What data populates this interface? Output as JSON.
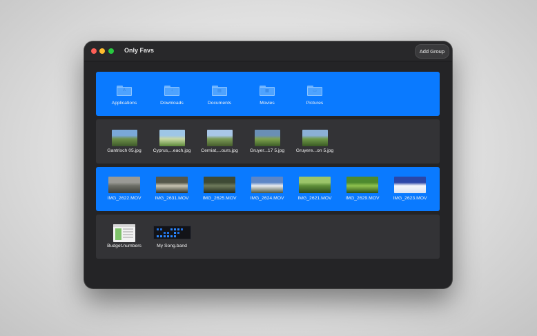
{
  "window": {
    "title": "Only Favs",
    "add_group_label": "Add Group"
  },
  "groups": [
    {
      "name": "folders",
      "selected": true,
      "items": [
        {
          "label": "Applications",
          "icon": "applications-folder-icon",
          "glyph": "A"
        },
        {
          "label": "Downloads",
          "icon": "downloads-folder-icon",
          "glyph": "↓"
        },
        {
          "label": "Documents",
          "icon": "documents-folder-icon",
          "glyph": "▤"
        },
        {
          "label": "Movies",
          "icon": "movies-folder-icon",
          "glyph": "▦"
        },
        {
          "label": "Pictures",
          "icon": "pictures-folder-icon",
          "glyph": "▭"
        }
      ]
    },
    {
      "name": "photos",
      "selected": false,
      "items": [
        {
          "label": "Gantrisch 05.jpg",
          "colors": [
            "#7aa8d8",
            "#6d8f4a",
            "#3e5a2a"
          ]
        },
        {
          "label": "Cyprus,...each.jpg",
          "colors": [
            "#9ec6e6",
            "#c9d9a3",
            "#5d8a3a"
          ]
        },
        {
          "label": "Cerniat,...ours.jpg",
          "colors": [
            "#a9c7e8",
            "#7c9b56",
            "#465d2c"
          ]
        },
        {
          "label": "Gruyer...17 5.jpg",
          "colors": [
            "#6a8fb5",
            "#7fa24e",
            "#3d5d27"
          ]
        },
        {
          "label": "Gruyere...on 5.jpg",
          "colors": [
            "#8bb0d6",
            "#6f9a49",
            "#3a5a23"
          ]
        }
      ]
    },
    {
      "name": "videos",
      "selected": true,
      "items": [
        {
          "label": "IMG_2622.MOV",
          "colors": [
            "#9a9a95",
            "#6b6e66",
            "#3f423c"
          ]
        },
        {
          "label": "IMG_2631.MOV",
          "colors": [
            "#55574a",
            "#c9c5b4",
            "#2f3328"
          ]
        },
        {
          "label": "IMG_2625.MOV",
          "colors": [
            "#3e4a35",
            "#6f7b5d",
            "#222a1c"
          ]
        },
        {
          "label": "IMG_2624.MOV",
          "colors": [
            "#5d86c6",
            "#e9ecf0",
            "#4a5640"
          ]
        },
        {
          "label": "IMG_2621.MOV",
          "colors": [
            "#9cc56a",
            "#5f8f39",
            "#2e4d1c"
          ]
        },
        {
          "label": "IMG_2629.MOV",
          "colors": [
            "#4d8a2e",
            "#8fc24f",
            "#2c5218"
          ]
        },
        {
          "label": "IMG_2623.MOV",
          "colors": [
            "#2a46a8",
            "#f4f6fb",
            "#d9e2f2"
          ]
        }
      ]
    },
    {
      "name": "documents",
      "selected": false,
      "items": [
        {
          "label": "Budget.numbers",
          "icon": "numbers-document-icon"
        },
        {
          "label": "My Song.band",
          "icon": "garageband-document-icon"
        }
      ]
    }
  ]
}
